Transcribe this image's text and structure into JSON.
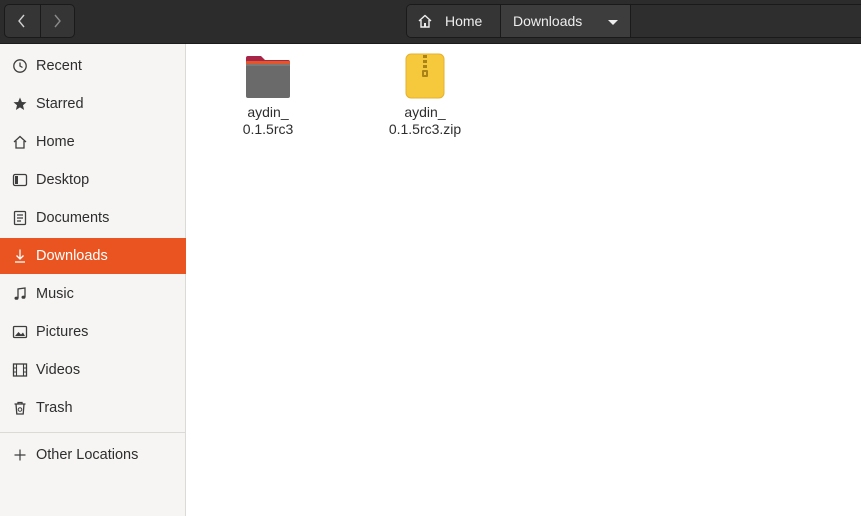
{
  "header": {
    "back_icon": "chevron-left-icon",
    "forward_icon": "chevron-right-icon",
    "breadcrumbs": [
      {
        "label": "Home",
        "icon": "home-icon"
      },
      {
        "label": "Downloads",
        "icon": "chevron-down-icon"
      }
    ]
  },
  "sidebar": {
    "accent_color": "#e95420",
    "items": [
      {
        "label": "Recent",
        "icon": "recent-icon"
      },
      {
        "label": "Starred",
        "icon": "star-icon"
      },
      {
        "label": "Home",
        "icon": "home-icon"
      },
      {
        "label": "Desktop",
        "icon": "desktop-icon"
      },
      {
        "label": "Documents",
        "icon": "documents-icon"
      },
      {
        "label": "Downloads",
        "icon": "downloads-icon",
        "active": true
      },
      {
        "label": "Music",
        "icon": "music-icon"
      },
      {
        "label": "Pictures",
        "icon": "pictures-icon"
      },
      {
        "label": "Videos",
        "icon": "videos-icon"
      },
      {
        "label": "Trash",
        "icon": "trash-icon"
      }
    ],
    "other_locations": {
      "label": "Other Locations",
      "icon": "plus-icon"
    }
  },
  "files": [
    {
      "name_line1": "aydin_",
      "name_line2": "0.1.5rc3",
      "icon": "folder-icon"
    },
    {
      "name_line1": "aydin_",
      "name_line2": "0.1.5rc3.zip",
      "icon": "zip-archive-icon"
    }
  ]
}
